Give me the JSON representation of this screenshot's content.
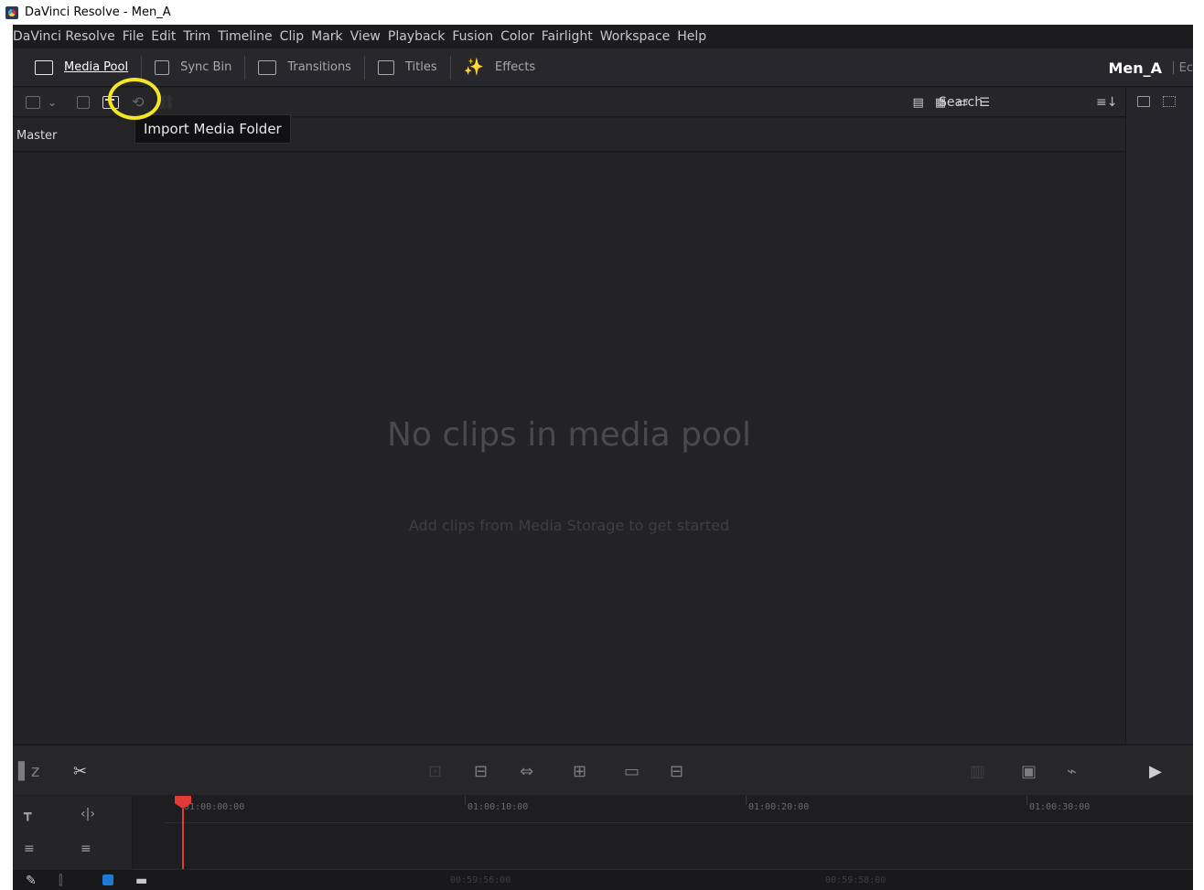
{
  "window": {
    "title": "DaVinci Resolve - Men_A"
  },
  "menu": [
    "DaVinci Resolve",
    "File",
    "Edit",
    "Trim",
    "Timeline",
    "Clip",
    "Mark",
    "View",
    "Playback",
    "Fusion",
    "Color",
    "Fairlight",
    "Workspace",
    "Help"
  ],
  "tabs": {
    "media_pool": "Media Pool",
    "sync_bin": "Sync Bin",
    "transitions": "Transitions",
    "titles": "Titles",
    "effects": "Effects"
  },
  "project": {
    "name": "Men_A",
    "extra": "Ec"
  },
  "search": {
    "placeholder": "Search"
  },
  "breadcrumb": "Master",
  "tooltip": "Import Media Folder",
  "empty_state": {
    "title": "No clips in media pool",
    "subtitle": "Add clips from Media Storage to get started"
  },
  "timeline": {
    "timecodes": [
      "01:00:00:00",
      "01:00:10:00",
      "01:00:20:00",
      "01:00:30:00"
    ]
  },
  "bottom_timecodes": [
    "00:59:56:00",
    "00:59:58:00"
  ],
  "colors": {
    "accent_yellow": "#f4e626",
    "playhead": "#e03a3a",
    "blue": "#1f7ad6"
  },
  "icons": {
    "media_pool": "media-pool-icon",
    "sync_bin": "sync-bin-icon",
    "transitions": "transitions-icon",
    "titles": "titles-icon",
    "effects": "effects-icon"
  }
}
